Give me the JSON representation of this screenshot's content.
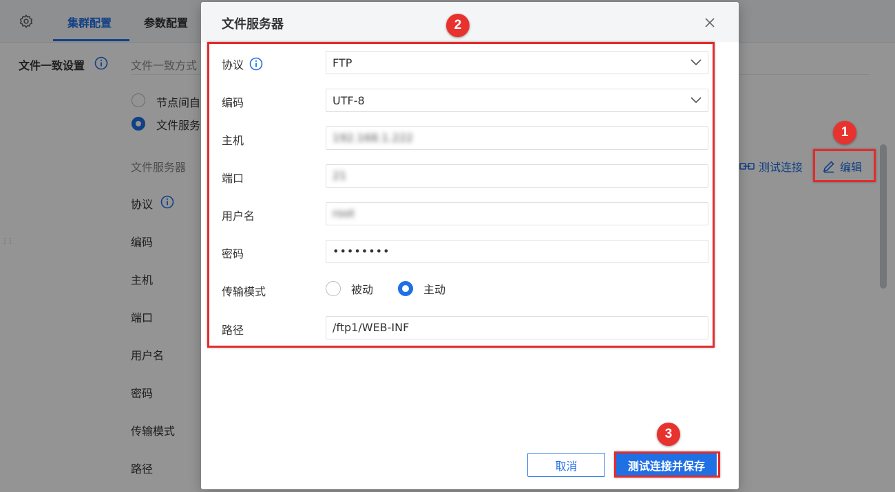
{
  "background": {
    "tabs": [
      {
        "label": "集群配置",
        "active": true
      },
      {
        "label": "参数配置",
        "active": false
      }
    ],
    "section_title": "文件一致设置",
    "consistency_label": "文件一致方式",
    "options": [
      {
        "label": "节点间自",
        "selected": false
      },
      {
        "label": "文件服务",
        "selected": true
      }
    ],
    "file_server_heading": "文件服务器",
    "fields": [
      "协议",
      "编码",
      "主机",
      "端口",
      "用户名",
      "密码",
      "传输模式",
      "路径"
    ],
    "test_link": "测试连接",
    "edit_link": "编辑"
  },
  "dialog": {
    "title": "文件服务器",
    "fields": {
      "protocol": {
        "label": "协议",
        "value": "FTP"
      },
      "encoding": {
        "label": "编码",
        "value": "UTF-8"
      },
      "host": {
        "label": "主机",
        "value": "192.168.1.222"
      },
      "port": {
        "label": "端口",
        "value": "21"
      },
      "username": {
        "label": "用户名",
        "value": "root"
      },
      "password": {
        "label": "密码",
        "value": "••••••••"
      },
      "transfer_mode": {
        "label": "传输模式",
        "options": [
          "被动",
          "主动"
        ],
        "selected": "主动"
      },
      "path": {
        "label": "路径",
        "value": "/ftp1/WEB-INF"
      }
    },
    "cancel_label": "取消",
    "save_label": "测试连接并保存"
  },
  "callouts": [
    "1",
    "2",
    "3"
  ],
  "colors": {
    "accent": "#1f6fe5",
    "highlight": "#e32b2b",
    "badge": "#e8322e",
    "overlay": "rgba(0,0,0,0.42)"
  },
  "icons": [
    "gear-icon",
    "info-icon",
    "link-icon",
    "edit-icon",
    "close-icon",
    "chevron-down-icon"
  ]
}
